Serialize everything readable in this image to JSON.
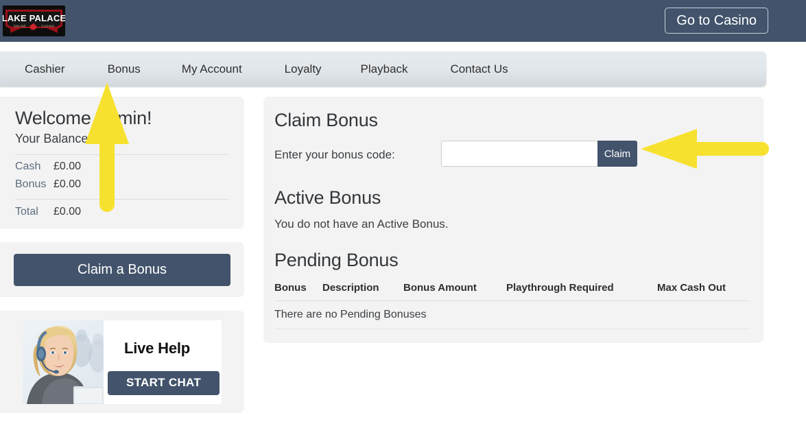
{
  "header": {
    "logo_line1": "LAKE PALACE",
    "logo_line2a": "ONLINE",
    "logo_line2b": "CASINO",
    "go_to_casino_label": "Go to Casino"
  },
  "nav": {
    "items": [
      {
        "label": "Cashier"
      },
      {
        "label": "Bonus"
      },
      {
        "label": "My Account"
      },
      {
        "label": "Loyalty"
      },
      {
        "label": "Playback"
      },
      {
        "label": "Contact Us"
      }
    ]
  },
  "sidebar": {
    "welcome_title": "Welcome Admin!",
    "balance_label": "Your Balance",
    "rows": [
      {
        "key": "Cash",
        "value": "£0.00"
      },
      {
        "key": "Bonus",
        "value": "£0.00"
      }
    ],
    "total": {
      "key": "Total",
      "value": "£0.00"
    },
    "claim_bonus_button": "Claim a Bonus",
    "live_help": {
      "title": "Live Help",
      "start_chat_label": "START CHAT"
    }
  },
  "main": {
    "claim_bonus_title": "Claim Bonus",
    "bonus_code_label": "Enter your bonus code:",
    "bonus_code_value": "",
    "bonus_code_placeholder": "",
    "claim_button_label": "Claim",
    "active_bonus_title": "Active Bonus",
    "active_bonus_empty": "You do not have an Active Bonus.",
    "pending_bonus_title": "Pending Bonus",
    "table": {
      "columns": [
        "Bonus",
        "Description",
        "Bonus Amount",
        "Playthrough Required",
        "Max Cash Out"
      ],
      "empty_message": "There are no Pending Bonuses",
      "rows": []
    }
  },
  "annotations": {
    "arrow_up_target": "Bonus",
    "arrow_left_target": "Claim"
  },
  "colors": {
    "brand_slate": "#42536b",
    "logo_red": "#9b1119",
    "annotation_yellow": "#f7e12f",
    "card_grey": "#f3f3f3",
    "nav_grey": "#e2e7eb"
  }
}
